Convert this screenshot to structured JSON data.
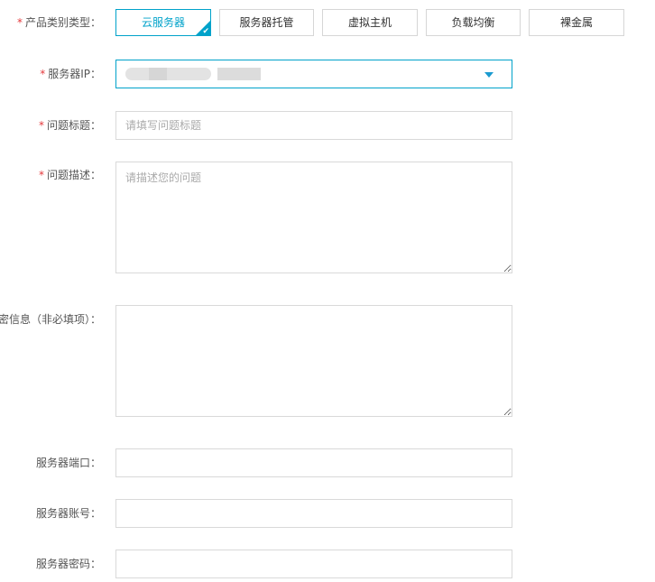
{
  "product_type": {
    "required_mark": "*",
    "label": "产品类别类型：",
    "options": [
      "云服务器",
      "服务器托管",
      "虚拟主机",
      "负载均衡",
      "裸金属"
    ],
    "selected_index": 0
  },
  "server_ip": {
    "required_mark": "*",
    "label": "服务器IP："
  },
  "issue_title": {
    "required_mark": "*",
    "label": "问题标题：",
    "placeholder": "请填写问题标题"
  },
  "issue_description": {
    "required_mark": "*",
    "label": "问题描述：",
    "placeholder": "请描述您的问题"
  },
  "extra_info": {
    "label": "密信息（非必填项）："
  },
  "server_port": {
    "label": "服务器端口："
  },
  "server_account": {
    "label": "服务器账号："
  },
  "server_password": {
    "label": "服务器密码："
  },
  "colors": {
    "accent": "#00a2ca",
    "required": "#e4393c"
  }
}
